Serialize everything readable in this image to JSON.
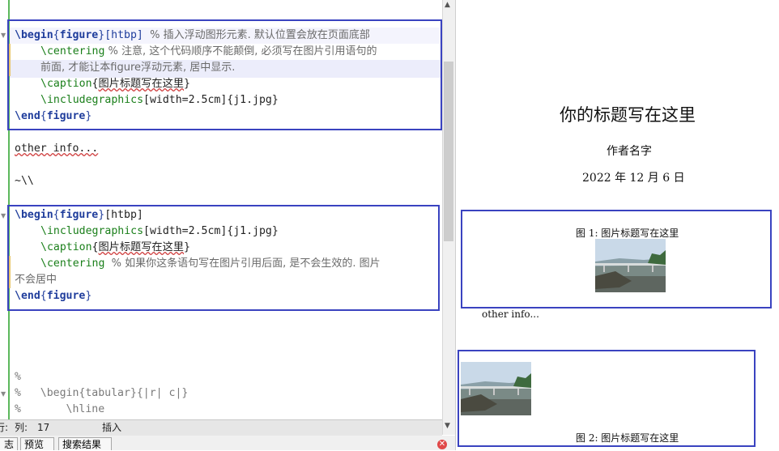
{
  "editor": {
    "lines": [
      {
        "kw1": "\\begin",
        "arg": "figure",
        "opt": "[htbp]",
        "comment": "  % 插入浮动图形元素. 默认位置会放在页面底部"
      },
      {
        "cmd": "\\centering",
        "comment": " % 注意, 这个代码顺序不能颠倒, 必须写在图片引用语句的"
      },
      {
        "text": "前面, 才能让本figure浮动元素, 居中显示."
      },
      {
        "cmd": "\\caption",
        "arg": "图片标题写在这里"
      },
      {
        "cmd": "\\includegraphics",
        "opt": "[width=2.5cm]",
        "arg": "j1.jpg"
      },
      {
        "kw1": "\\end",
        "arg": "figure"
      },
      {
        "text": "other info..."
      },
      {
        "text": "~\\\\"
      },
      {
        "kw1": "\\begin",
        "arg": "figure",
        "opt": "[htbp]"
      },
      {
        "cmd": "\\includegraphics",
        "opt": "[width=2.5cm]",
        "arg": "j1.jpg"
      },
      {
        "cmd": "\\caption",
        "arg": "图片标题写在这里"
      },
      {
        "cmd": "\\centering",
        "comment": "  % 如果你这条语句写在图片引用后面, 是不会生效的. 图片"
      },
      {
        "text": "不会居中"
      },
      {
        "kw1": "\\end",
        "arg": "figure"
      },
      {
        "text": "%"
      },
      {
        "text": "%   \\begin{tabular}{|r| c|}"
      },
      {
        "text": "%       \\hline"
      }
    ]
  },
  "status": {
    "line_label": "行:",
    "col_label": "列:",
    "col_value": "17",
    "mode": "插入"
  },
  "bottom_tabs": [
    "志",
    "预览",
    "搜索结果"
  ],
  "preview": {
    "title": "你的标题写在这里",
    "author": "作者名字",
    "date": "2022 年 12 月 6 日",
    "fig1_caption": "图 1: 图片标题写在这里",
    "body_text": "other info...",
    "fig2_caption": "图 2: 图片标题写在这里"
  },
  "colors": {
    "annotation_box": "#3a43c0",
    "keyword": "#1f3d9c",
    "command": "#1a7f1a",
    "current_line": "#ecedfb"
  }
}
